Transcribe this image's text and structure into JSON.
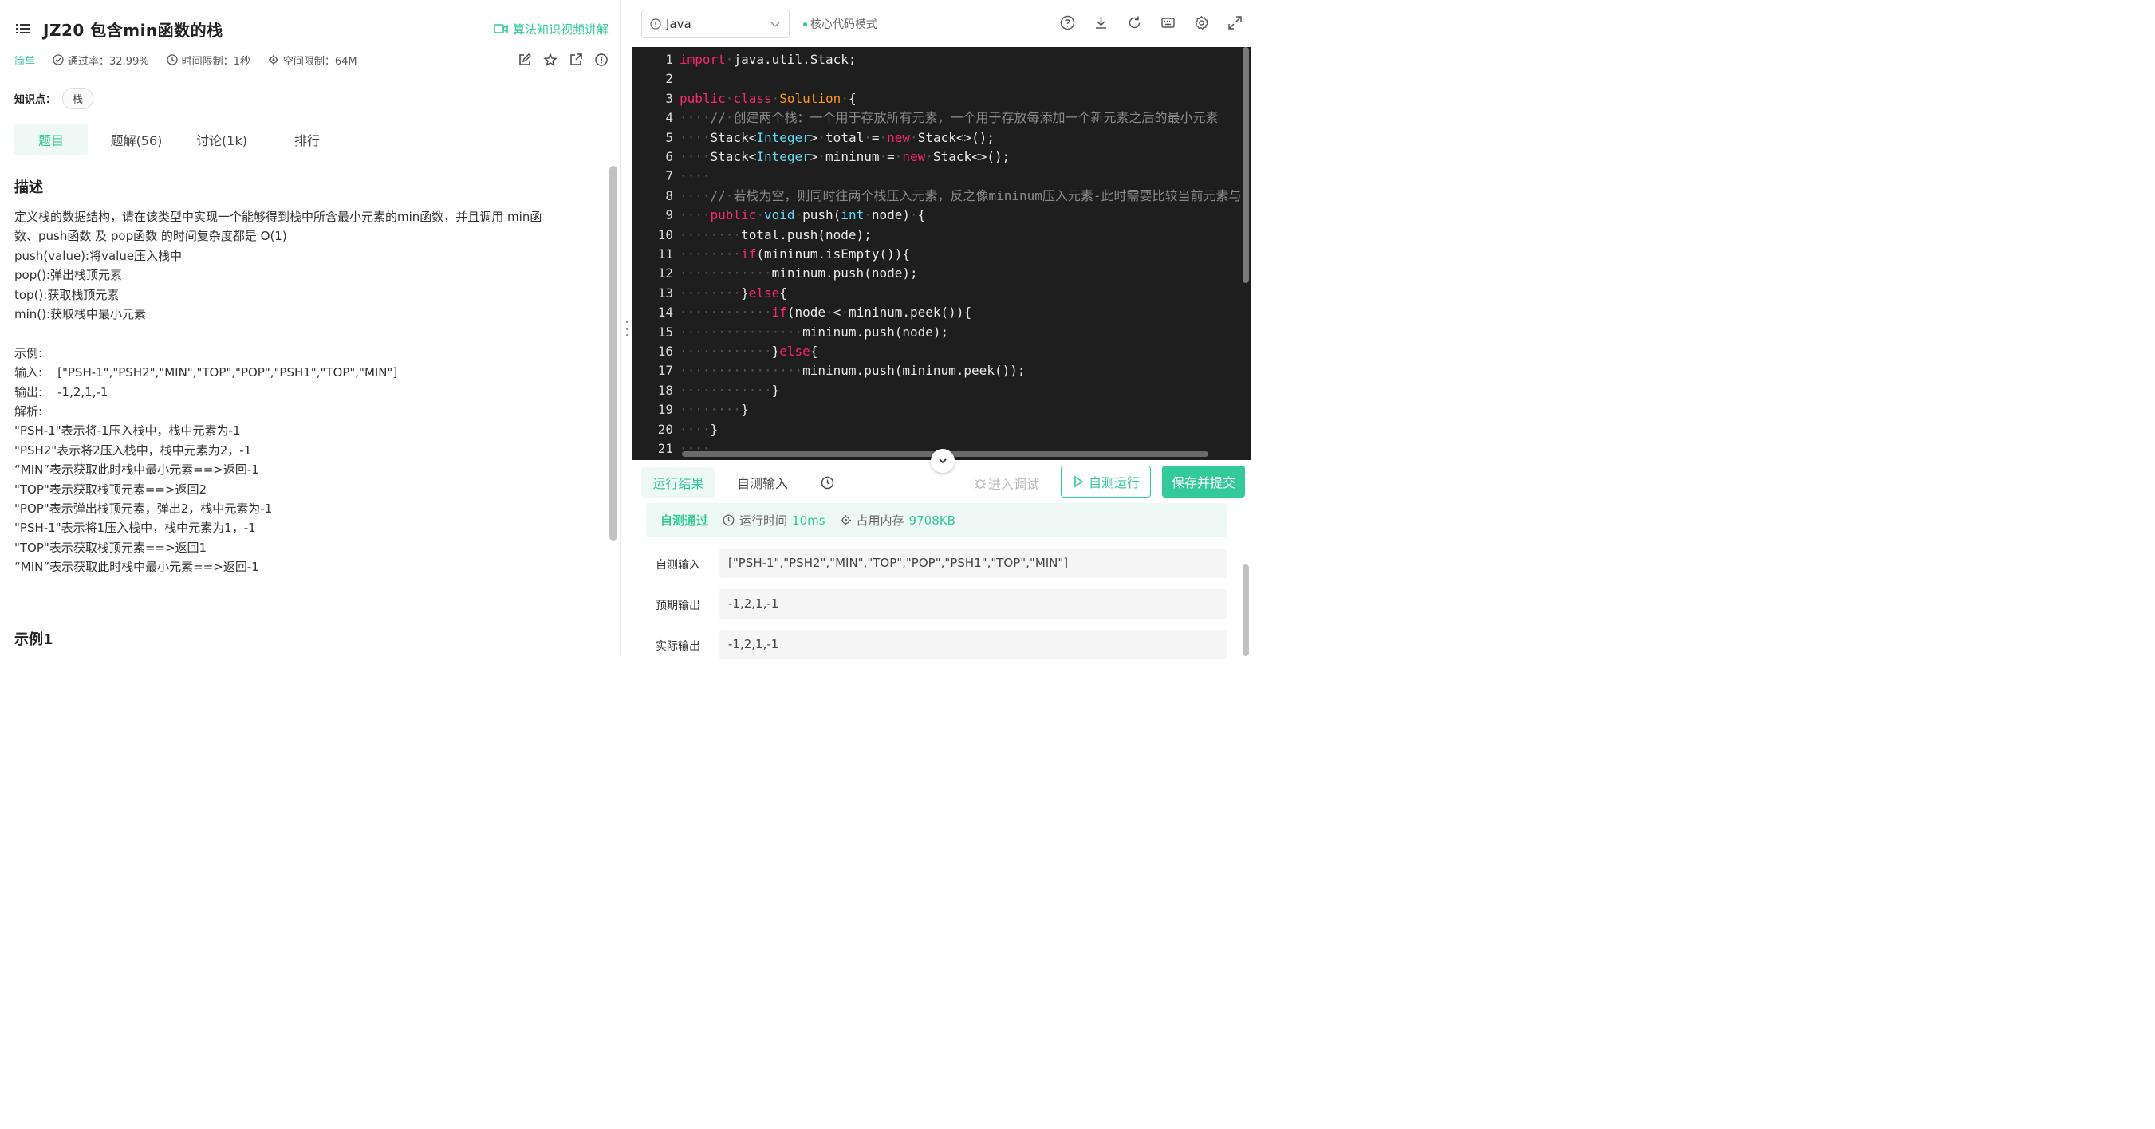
{
  "problem": {
    "title": "JZ20  包含min函数的栈",
    "video_link": "算法知识视频讲解",
    "difficulty": "简单",
    "pass_rate": "通过率：32.99%",
    "time_limit": "时间限制：1秒",
    "space_limit": "空间限制：64M",
    "knowledge_label": "知识点：",
    "knowledge_tag": "栈"
  },
  "tabs": [
    "题目",
    "题解(56)",
    "讨论(1k)",
    "排行"
  ],
  "description": {
    "heading": "描述",
    "lines": [
      "定义栈的数据结构，请在该类型中实现一个能够得到栈中所含最小元素的min函数，并且调用 min函",
      "数、push函数 及 pop函数 的时间复杂度都是 O(1)",
      "push(value):将value压入栈中",
      "pop():弹出栈顶元素",
      "top():获取栈顶元素",
      "min():获取栈中最小元素",
      "",
      "示例:",
      "输入:    [\"PSH-1\",\"PSH2\",\"MIN\",\"TOP\",\"POP\",\"PSH1\",\"TOP\",\"MIN\"]",
      "输出:    -1,2,1,-1",
      "解析:",
      "\"PSH-1\"表示将-1压入栈中，栈中元素为-1",
      "\"PSH2\"表示将2压入栈中，栈中元素为2，-1",
      "“MIN”表示获取此时栈中最小元素==>返回-1",
      "\"TOP\"表示获取栈顶元素==>返回2",
      "\"POP\"表示弹出栈顶元素，弹出2，栈中元素为-1",
      "\"PSH-1\"表示将1压入栈中，栈中元素为1，-1",
      "\"TOP\"表示获取栈顶元素==>返回1",
      "“MIN”表示获取此时栈中最小元素==>返回-1"
    ],
    "example_heading": "示例1"
  },
  "editor": {
    "language": "Java",
    "mode": "核心代码模式",
    "line_numbers": [
      "1",
      "2",
      "3",
      "4",
      "5",
      "6",
      "7",
      "8",
      "9",
      "10",
      "11",
      "12",
      "13",
      "14",
      "15",
      "16",
      "17",
      "18",
      "19",
      "20",
      "21"
    ],
    "code_lines": [
      "import java.util.Stack;",
      "",
      "public class Solution {",
      "    // 创建两个栈：一个用于存放所有元素，一个用于存放每添加一个新元素之后的最小元素",
      "    Stack<Integer> total = new Stack<>();",
      "    Stack<Integer> mininum = new Stack<>();",
      "    ",
      "    // 若栈为空，则同时往两个栈压入元素，反之像mininum压入元素-此时需要比较当前元素与",
      "    public void push(int node) {",
      "        total.push(node);",
      "        if(mininum.isEmpty()){",
      "            mininum.push(node);",
      "        }else{",
      "            if(node < mininum.peek()){",
      "                mininum.push(node);",
      "            }else{",
      "                mininum.push(mininum.peek());",
      "            }",
      "        }",
      "    }",
      "    "
    ]
  },
  "result": {
    "tab_result": "运行结果",
    "tab_custom_input": "自测输入",
    "debug": "进入调试",
    "run_button": "自测运行",
    "submit_button": "保存并提交",
    "status": "自测通过",
    "runtime_label": "运行时间",
    "runtime_value": "10ms",
    "memory_label": "占用内存",
    "memory_value": "9708KB",
    "rows": [
      {
        "label": "自测输入",
        "value": "[\"PSH-1\",\"PSH2\",\"MIN\",\"TOP\",\"POP\",\"PSH1\",\"TOP\",\"MIN\"]"
      },
      {
        "label": "预期输出",
        "value": "-1,2,1,-1"
      },
      {
        "label": "实际输出",
        "value": "-1,2,1,-1"
      }
    ]
  },
  "colors": {
    "accent": "#32ca99",
    "editor_bg": "#1e1e1e",
    "keyword": "#f92672",
    "type": "#66d9ef",
    "class_name": "#fd971f",
    "comment": "#8a8a8a"
  }
}
